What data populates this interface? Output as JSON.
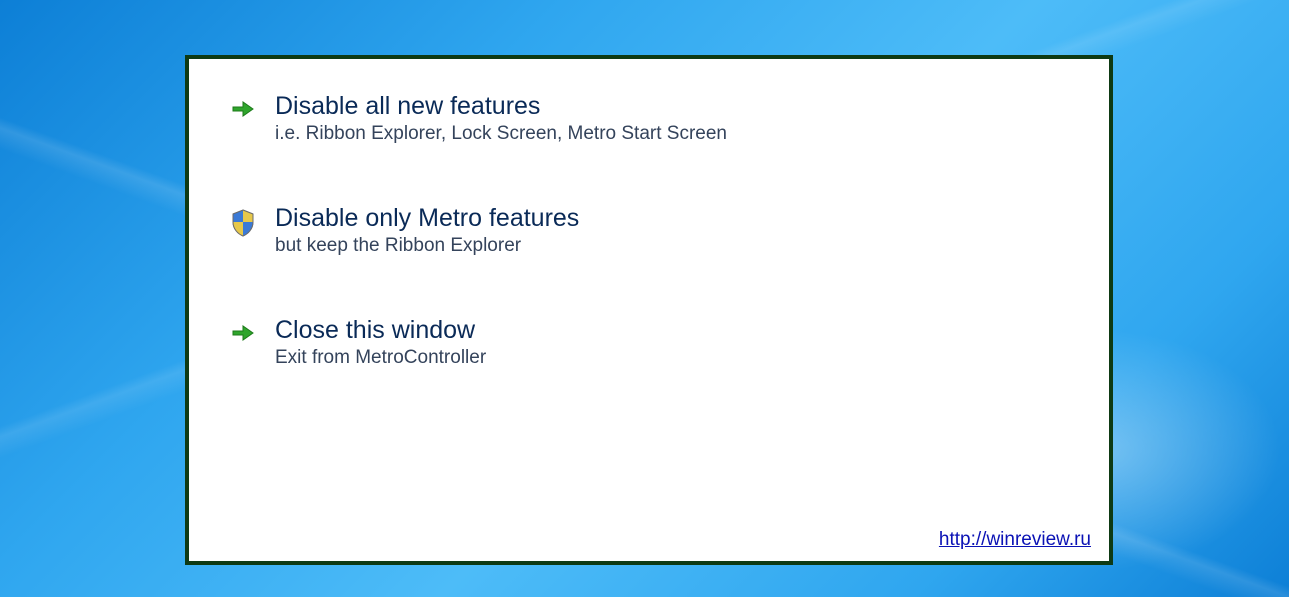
{
  "options": [
    {
      "title": "Disable all new features",
      "subtitle": "i.e. Ribbon Explorer, Lock Screen, Metro Start Screen",
      "icon": "arrow"
    },
    {
      "title": "Disable only Metro features",
      "subtitle": "but keep the Ribbon Explorer",
      "icon": "shield"
    },
    {
      "title": "Close this window",
      "subtitle": "Exit from MetroController",
      "icon": "arrow"
    }
  ],
  "footer": {
    "link": "http://winreview.ru"
  }
}
